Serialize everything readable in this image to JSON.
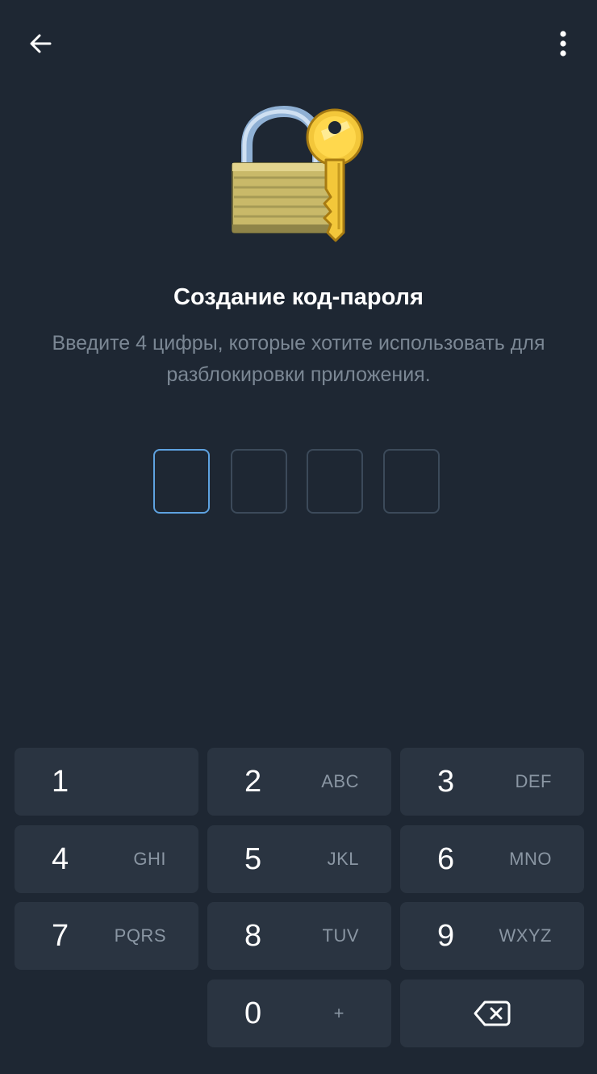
{
  "header": {
    "back_icon": "arrow-left-icon",
    "menu_icon": "more-vertical-icon"
  },
  "illustration": {
    "icon": "lock-with-key-icon"
  },
  "title": "Создание код-пароля",
  "subtitle_line1": "Введите 4 цифры, которые хотите использовать для",
  "subtitle_line2": "разблокировки приложения.",
  "code": {
    "length": 4,
    "active_index": 0,
    "filled": 0
  },
  "keypad": {
    "k1": {
      "digit": "1",
      "letters": ""
    },
    "k2": {
      "digit": "2",
      "letters": "ABC"
    },
    "k3": {
      "digit": "3",
      "letters": "DEF"
    },
    "k4": {
      "digit": "4",
      "letters": "GHI"
    },
    "k5": {
      "digit": "5",
      "letters": "JKL"
    },
    "k6": {
      "digit": "6",
      "letters": "MNO"
    },
    "k7": {
      "digit": "7",
      "letters": "PQRS"
    },
    "k8": {
      "digit": "8",
      "letters": "TUV"
    },
    "k9": {
      "digit": "9",
      "letters": "WXYZ"
    },
    "k0": {
      "digit": "0",
      "letters": "+"
    },
    "backspace_icon": "backspace-icon"
  },
  "colors": {
    "background": "#1e2733",
    "key": "#2a3441",
    "active_box": "#5ea2e0",
    "inactive_box": "#3c4a5a",
    "muted_text": "#7b8794"
  }
}
